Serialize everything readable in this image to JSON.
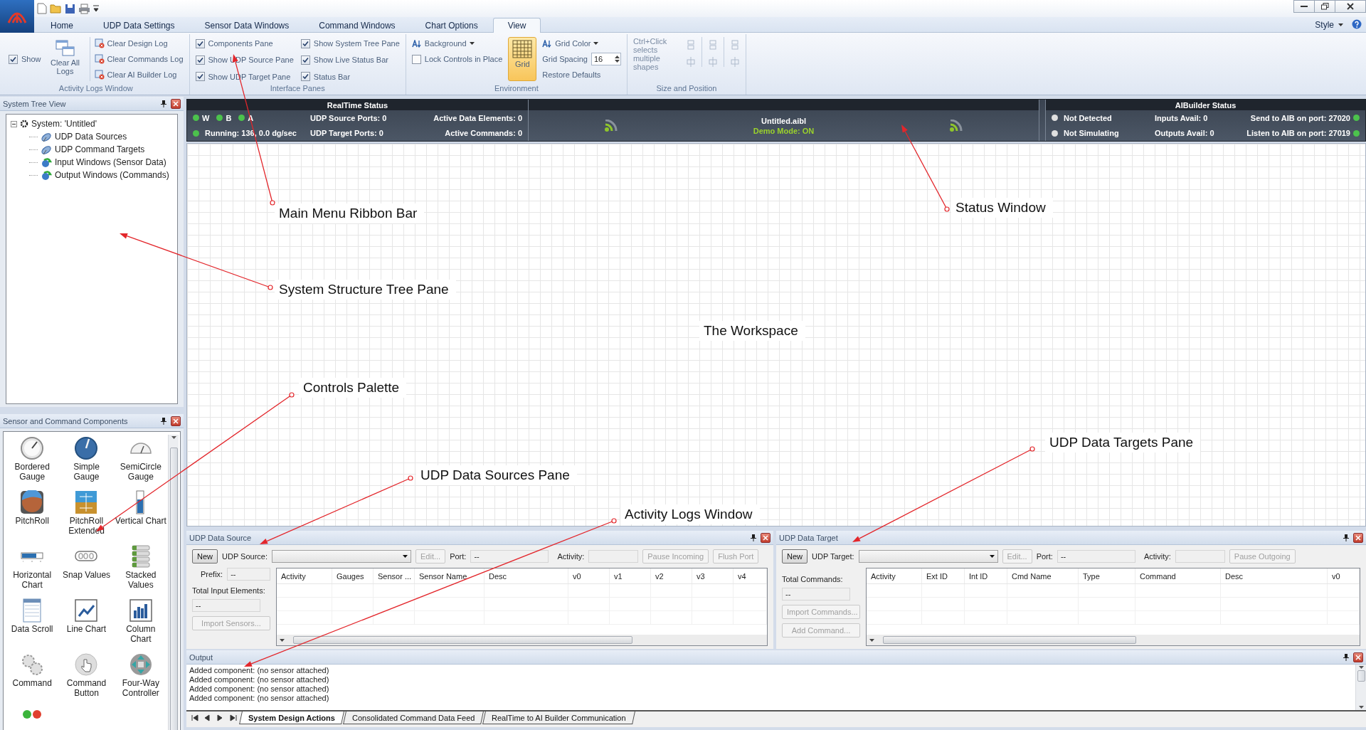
{
  "ribbon": {
    "tabs": [
      {
        "label": "Home",
        "selected": false
      },
      {
        "label": "UDP Data Settings",
        "selected": false
      },
      {
        "label": "Sensor Data Windows",
        "selected": false
      },
      {
        "label": "Command Windows",
        "selected": false
      },
      {
        "label": "Chart Options",
        "selected": false
      },
      {
        "label": "View",
        "selected": true
      }
    ],
    "style_menu": "Style",
    "activity_logs": {
      "title": "Activity Logs Window",
      "show": {
        "label": "Show",
        "checked": true
      },
      "clear_all": "Clear All Logs",
      "clear_buttons": [
        "Clear Design Log",
        "Clear Commands Log",
        "Clear AI Builder Log"
      ]
    },
    "interface_panes": {
      "title": "Interface Panes",
      "options": [
        {
          "label": "Components Pane",
          "checked": true
        },
        {
          "label": "Show UDP Source Pane",
          "checked": true
        },
        {
          "label": "Show UDP Target Pane",
          "checked": true
        },
        {
          "label": "Show System Tree Pane",
          "checked": true
        },
        {
          "label": "Show Live Status Bar",
          "checked": true
        },
        {
          "label": "Status Bar",
          "checked": true
        }
      ]
    },
    "environment": {
      "title": "Environment",
      "background": "Background",
      "lock": {
        "label": "Lock Controls in Place",
        "checked": false
      },
      "grid": {
        "label": "Grid",
        "selected": true
      },
      "grid_color": "Grid Color",
      "grid_spacing": {
        "label": "Grid Spacing",
        "value": "16"
      },
      "restore": "Restore Defaults"
    },
    "size_position": {
      "title": "Size and Position",
      "hint": "Ctrl+Click selects multiple shapes"
    }
  },
  "tree_pane": {
    "title": "System Tree View",
    "tree": [
      {
        "label": "System: 'Untitled'",
        "expanded": true,
        "children": [
          {
            "label": "UDP Data Sources"
          },
          {
            "label": "UDP Command Targets"
          },
          {
            "label": "Input Windows (Sensor Data)"
          },
          {
            "label": "Output Windows (Commands)"
          }
        ]
      }
    ]
  },
  "palette": {
    "title": "Sensor and Command Components",
    "items": [
      {
        "label": "Bordered\nGauge"
      },
      {
        "label": "Simple\nGauge"
      },
      {
        "label": "SemiCircle\nGauge"
      },
      {
        "label": "PitchRoll"
      },
      {
        "label": "PitchRoll\nExtended"
      },
      {
        "label": "Vertical Chart"
      },
      {
        "label": "Horizontal\nChart"
      },
      {
        "label": "Snap Values"
      },
      {
        "label": "Stacked\nValues"
      },
      {
        "label": "Data Scroll"
      },
      {
        "label": "Line Chart"
      },
      {
        "label": "Column\nChart"
      },
      {
        "label": "Command"
      },
      {
        "label": "Command\nButton"
      },
      {
        "label": "Four-Way\nController"
      }
    ]
  },
  "status": {
    "realtime": {
      "title": "RealTime Status",
      "indicators": [
        {
          "label": "W",
          "color": "#4cc24c"
        },
        {
          "label": "B",
          "color": "#4cc24c"
        },
        {
          "label": "A",
          "color": "#4cc24c"
        }
      ],
      "running": {
        "label": "Running: 136, 0.0 dg/sec",
        "color": "#4cc24c"
      },
      "source_ports": "UDP Source Ports: 0",
      "target_ports": "UDP Target Ports: 0",
      "active_elements": "Active Data Elements: 0",
      "active_commands": "Active Commands: 0"
    },
    "center": {
      "file": "Untitled.aibl",
      "mode": "Demo Mode: ON"
    },
    "aibuilder": {
      "title": "AIBuilder Status",
      "rows": [
        {
          "state": {
            "label": "Not Detected",
            "color": "#e0e0e0"
          },
          "avail": "Inputs Avail: 0",
          "port": {
            "label": "Send to AIB on port: 27020",
            "color": "#4cc24c"
          }
        },
        {
          "state": {
            "label": "Not Simulating",
            "color": "#e0e0e0"
          },
          "avail": "Outputs Avail: 0",
          "port": {
            "label": "Listen to AIB on port: 27019",
            "color": "#4cc24c"
          }
        }
      ]
    }
  },
  "udp_source": {
    "title": "UDP Data Source",
    "new_button": {
      "label": "New",
      "disabled": false
    },
    "combo_label": "UDP Source:",
    "edit_button": {
      "label": "Edit...",
      "disabled": true
    },
    "port_label": "Port:",
    "port_value": "--",
    "activity_label": "Activity:",
    "buttons": [
      {
        "label": "Pause Incoming",
        "disabled": true
      },
      {
        "label": "Flush Port",
        "disabled": true
      }
    ],
    "prefix_label": "Prefix:",
    "prefix_value": "--",
    "total_label": "Total Input Elements:",
    "total_value": "--",
    "side_buttons": [
      {
        "label": "Import Sensors...",
        "disabled": true
      }
    ],
    "columns": [
      "Activity",
      "Gauges",
      "Sensor ...",
      "Sensor Name",
      "Desc",
      "v0",
      "v1",
      "v2",
      "v3",
      "v4"
    ]
  },
  "udp_target": {
    "title": "UDP Data Target",
    "new_button": {
      "label": "New",
      "disabled": false
    },
    "combo_label": "UDP Target:",
    "edit_button": {
      "label": "Edit...",
      "disabled": true
    },
    "port_label": "Port:",
    "port_value": "--",
    "activity_label": "Activity:",
    "buttons": [
      {
        "label": "Pause Outgoing",
        "disabled": true
      }
    ],
    "total_label": "Total Commands:",
    "total_value": "--",
    "side_buttons": [
      {
        "label": "Import Commands...",
        "disabled": true
      },
      {
        "label": "Add Command...",
        "disabled": true
      }
    ],
    "columns": [
      "Activity",
      "Ext ID",
      "Int ID",
      "Cmd Name",
      "Type",
      "Command",
      "Desc",
      "v0"
    ]
  },
  "output": {
    "title": "Output",
    "lines": [
      "Added component: (no sensor attached)",
      "Added component: (no sensor attached)",
      "Added component: (no sensor attached)",
      "Added component: (no sensor attached)"
    ],
    "tabs": [
      {
        "label": "System Design Actions",
        "selected": true
      },
      {
        "label": "Consolidated Command Data Feed",
        "selected": false
      },
      {
        "label": "RealTime to AI Builder Communication",
        "selected": false
      }
    ]
  },
  "callouts": [
    {
      "text": "Main Menu Ribbon Bar",
      "kind": "arrow"
    },
    {
      "text": "Status Window",
      "kind": "arrow"
    },
    {
      "text": "System Structure Tree Pane",
      "kind": "arrow"
    },
    {
      "text": "The Workspace",
      "kind": "plain"
    },
    {
      "text": "Controls Palette",
      "kind": "arrow"
    },
    {
      "text": "UDP Data Targets Pane",
      "kind": "arrow"
    },
    {
      "text": "UDP Data Sources Pane",
      "kind": "arrow"
    },
    {
      "text": "Activity Logs Window",
      "kind": "arrow"
    }
  ]
}
